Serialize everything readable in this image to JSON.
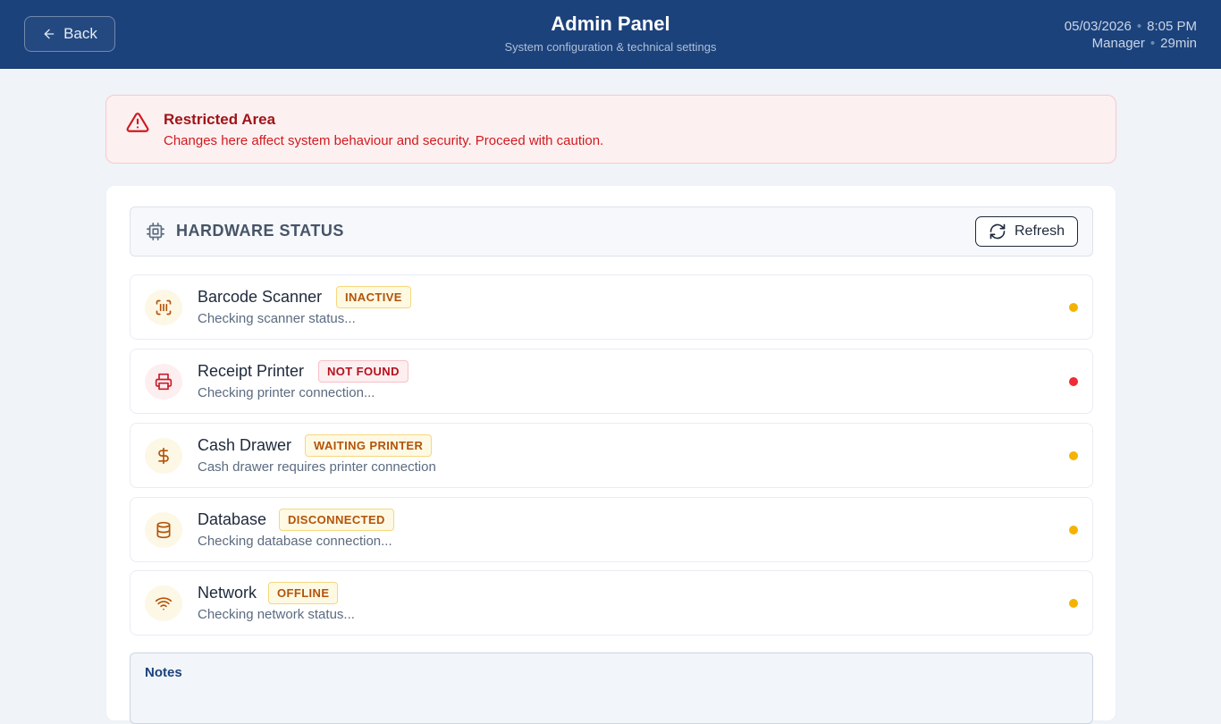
{
  "header": {
    "back_label": "Back",
    "title": "Admin Panel",
    "subtitle": "System configuration & technical settings",
    "date": "05/03/2026",
    "time": "8:05 PM",
    "role": "Manager",
    "session": "29min",
    "separator": "•"
  },
  "alert": {
    "title": "Restricted Area",
    "message": "Changes here affect system behaviour and security. Proceed with caution."
  },
  "hardware": {
    "section_title": "HARDWARE STATUS",
    "refresh_label": "Refresh",
    "devices": [
      {
        "name": "Barcode Scanner",
        "badge": "INACTIVE",
        "detail": "Checking scanner status...",
        "icon": "barcode-scan-icon",
        "tone": "amber"
      },
      {
        "name": "Receipt Printer",
        "badge": "NOT FOUND",
        "detail": "Checking printer connection...",
        "icon": "printer-icon",
        "tone": "red"
      },
      {
        "name": "Cash Drawer",
        "badge": "WAITING PRINTER",
        "detail": "Cash drawer requires printer connection",
        "icon": "dollar-icon",
        "tone": "amber"
      },
      {
        "name": "Database",
        "badge": "DISCONNECTED",
        "detail": "Checking database connection...",
        "icon": "database-icon",
        "tone": "amber"
      },
      {
        "name": "Network",
        "badge": "OFFLINE",
        "detail": "Checking network status...",
        "icon": "wifi-icon",
        "tone": "amber"
      }
    ]
  },
  "notes": {
    "title": "Notes"
  },
  "colors": {
    "header_bg": "#1c427c",
    "alert_text": "#d01a20",
    "amber": "#f5b301",
    "red": "#ef2b36",
    "amber_icon": "#b45309",
    "red_icon": "#c81e2a"
  }
}
